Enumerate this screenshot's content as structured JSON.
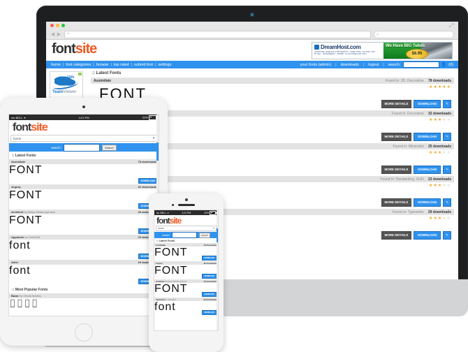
{
  "site": {
    "logo_font": "font",
    "logo_site": "site",
    "accent_orange": "#f15a24",
    "accent_blue": "#2f92ee"
  },
  "browser": {
    "url_placeholder": "",
    "search_placeholder": "",
    "back_icon": "back-arrow-icon",
    "forward_icon": "forward-arrow-icon",
    "new_tab_icon": "plus-icon",
    "search_icon": "magnifier-icon",
    "resize_icon": "resize-icon",
    "traffic_lights": [
      "close",
      "minimize",
      "zoom"
    ]
  },
  "banner": {
    "brand": "DreamHost.com",
    "subtitle": "UNLIMITED DOMAINS & BANDWIDTH · FREE TRIAL, NO RISK\nPHP · MYSQL · WORDPRESS · PHPBB · PLUS MORE FOR ONLY",
    "headline": "We Have BIG Tubes",
    "price": "$8.95"
  },
  "nav": {
    "primary": [
      "home",
      "font categories",
      "browse",
      "top rated",
      "submit font",
      "settings"
    ],
    "secondary": [
      "your fonts (admin)",
      "downloads",
      "logout"
    ],
    "search_label": "search:",
    "search_value": "",
    "user_count": "(0)",
    "user_icon": "user-icon"
  },
  "ad": {
    "brand_bold": "Team",
    "brand_light": "Viewer",
    "badge": "10th"
  },
  "desktop": {
    "section_title": ":: Latest Fonts",
    "rows": [
      {
        "name": "Assimilate",
        "author": "",
        "categories": "Found in: 3D, Decorative",
        "downloads": "78 downloads",
        "stars": 5,
        "word": "FONT"
      },
      {
        "name": "Argosy",
        "author": "",
        "categories": "Found in: Decorative",
        "downloads": "32 downloads",
        "stars": 3,
        "word": "FONT"
      },
      {
        "name": "Architext",
        "author": "by Altsys Metamorphosis",
        "categories": "Found in: Minimalist",
        "downloads": "25 downloads",
        "stars": 3,
        "word": "FONT"
      },
      {
        "name": "Appstock",
        "author": "by TanisSoft",
        "categories": "Found in: Handwriting, SciFi",
        "downloads": "23 downloads",
        "stars": 3,
        "word": "font"
      },
      {
        "name": "Adler",
        "author": "",
        "categories": "Found in: Typewriter",
        "downloads": "29 downloads",
        "stars": 3,
        "word": "font"
      }
    ],
    "btn_details": "MORE DETAILS",
    "btn_download": "DOWNLOAD",
    "btn_icon": "share-icon"
  },
  "mobile": {
    "status": {
      "signal": "•••••",
      "carrier": "BELL",
      "wifi_icon": "wifi-icon",
      "time": "4:21 PM",
      "battery": "22%"
    },
    "select_value": "home",
    "select_icon": "chevron-down-icon",
    "search_label": "search:",
    "search_value": "",
    "search_button": "Search",
    "latest_title": ":: Latest Fonts",
    "popular_title": ":: Most Popular Fonts",
    "download_button": "DOWNLOAD",
    "latest": [
      {
        "name": "Assimilate",
        "author": "",
        "downloads": "78 downloads",
        "word": "FONT"
      },
      {
        "name": "Argosy",
        "author": "",
        "downloads": "32 downloads",
        "word": "FONT"
      },
      {
        "name": "Architext",
        "author": "by Altsys Metamorphosis",
        "downloads": "25 downloads",
        "word": "FONT"
      },
      {
        "name": "Appstock",
        "author": "by TanisSoft",
        "downloads": "23 downloads",
        "word": "font"
      },
      {
        "name": "Adler",
        "author": "",
        "downloads": "29 downloads",
        "word": "font"
      }
    ],
    "popular": [
      {
        "name": "Bazar",
        "author": "by Olinda Martins",
        "downloads": "",
        "word": "⌷⌷⌷⌷"
      }
    ]
  }
}
